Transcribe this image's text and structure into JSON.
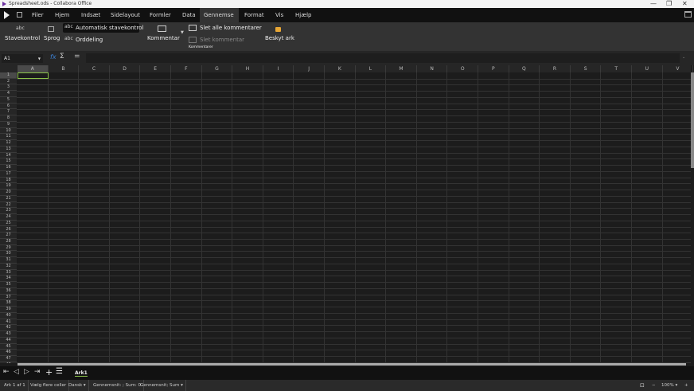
{
  "window": {
    "title": "Spreadsheet.ods - Collabora Office",
    "minimize": "—",
    "restore": "❐",
    "close": "✕"
  },
  "menu": {
    "items": [
      "Filer",
      "Hjem",
      "Indsæt",
      "Sidelayout",
      "Formler",
      "Data",
      "Gennemse",
      "Format",
      "Vis",
      "Hjælp"
    ],
    "active": "Gennemse"
  },
  "ribbon": {
    "spellcheck": "Stavekontrol",
    "language": "Sprog",
    "auto_spellcheck": "Automatisk stavekontrol",
    "hyphenation": "Orddeling",
    "comment": "Kommentar",
    "delete_all_comments": "Slet alle kommentarer",
    "delete_comment": "Slet kommentar",
    "comments_group": "Kommentarer",
    "protect_sheet": "Beskyt ark"
  },
  "formula_bar": {
    "name_box": "A1",
    "value": ""
  },
  "grid": {
    "columns": [
      "A",
      "B",
      "C",
      "D",
      "E",
      "F",
      "G",
      "H",
      "I",
      "J",
      "K",
      "L",
      "M",
      "N",
      "O",
      "P",
      "Q",
      "R",
      "S",
      "T",
      "U",
      "V"
    ],
    "rows": 48,
    "selected_cell": "A1"
  },
  "sheets": {
    "tabs": [
      "Ark1"
    ],
    "active": "Ark1"
  },
  "status": {
    "sheet": "Ark 1 af 1",
    "selection_mode": "Vælg flere celler",
    "language": "Dansk",
    "sum": "Gennemsnit: ; Sum: 0",
    "function": "Gennemsnit; Sum",
    "zoom": "100%"
  },
  "colors": {
    "accent": "#8bc34a",
    "background": "#1c1c1c",
    "menubar": "#111111",
    "ribbon": "#333333"
  }
}
